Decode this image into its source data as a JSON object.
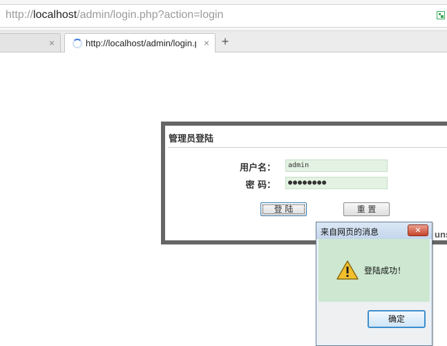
{
  "browser": {
    "url_prefix": "http://",
    "url_host": "localhost",
    "url_path": "/admin/login.php?action=login",
    "qr_icon": "qr-code-icon",
    "tabs": [
      {
        "title": "",
        "close": "×"
      },
      {
        "title": "http://localhost/admin/login.php?action=login",
        "close": "×",
        "loading": true
      }
    ],
    "new_tab": "+"
  },
  "login": {
    "title": "管理员登陆",
    "username_label": "用户名：",
    "password_label": "密 码：",
    "username_value": "admin",
    "password_value": "●●●●●●●●",
    "login_button": "登 陆",
    "reset_button": "重 置",
    "partial_text": "uns"
  },
  "alert": {
    "title": "来自网页的消息",
    "close": "✕",
    "message": "登陆成功！",
    "ok_button": "确定",
    "icon": "warning-icon"
  }
}
